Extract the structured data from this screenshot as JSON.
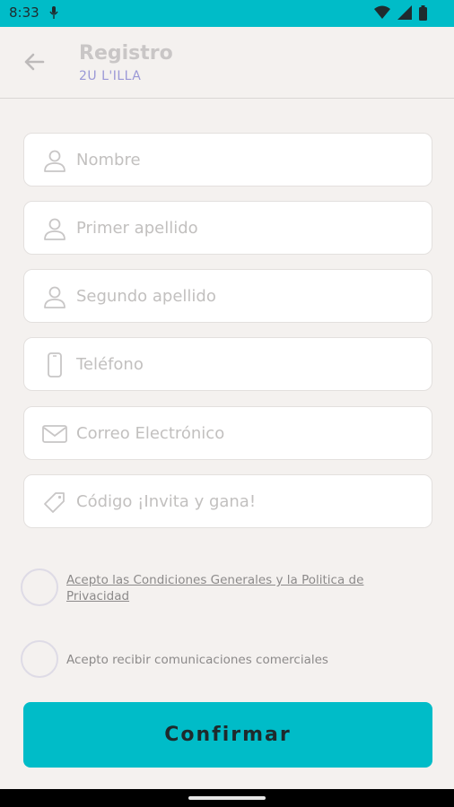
{
  "status": {
    "time": "8:33"
  },
  "header": {
    "title": "Registro",
    "subtitle": "2U L'ILLA"
  },
  "form": {
    "nombre": {
      "placeholder": "Nombre",
      "icon": "person-icon"
    },
    "primer_apellido": {
      "placeholder": "Primer apellido",
      "icon": "person-icon"
    },
    "segundo_apellido": {
      "placeholder": "Segundo apellido",
      "icon": "person-icon"
    },
    "telefono": {
      "placeholder": "Teléfono",
      "icon": "phone-icon"
    },
    "correo": {
      "placeholder": "Correo Electrónico",
      "icon": "mail-icon"
    },
    "codigo": {
      "placeholder": "Código ¡Invita y gana!",
      "icon": "tag-icon"
    }
  },
  "checks": {
    "terms": "Acepto las Condiciones Generales y la Politica de Privacidad",
    "marketing": "Acepto recibir comunicaciones comerciales"
  },
  "actions": {
    "confirm": "Confirmar"
  },
  "colors": {
    "accent": "#00bcc8",
    "background": "#f4f1ef",
    "subtitle": "#9b98d6"
  }
}
